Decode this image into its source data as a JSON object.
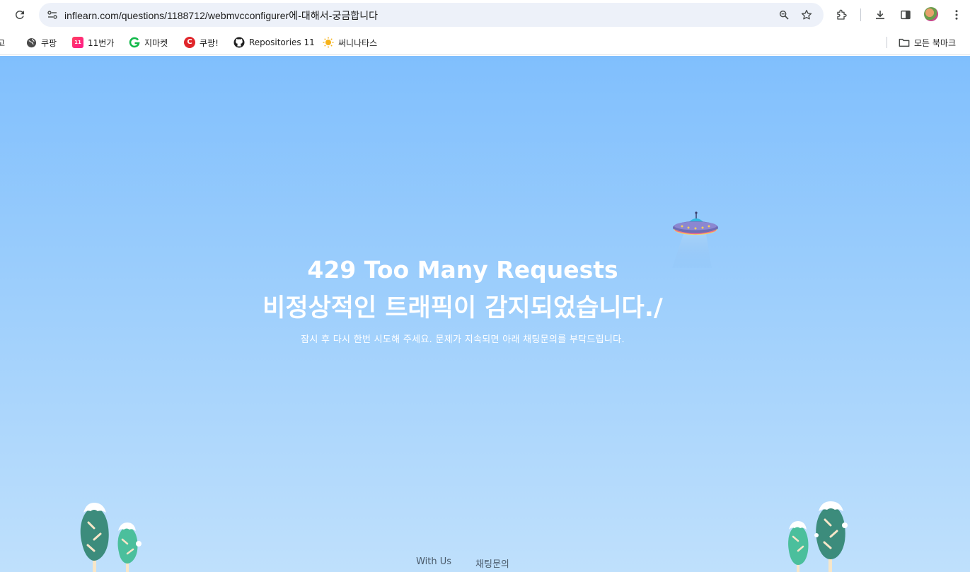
{
  "browser": {
    "url": "inflearn.com/questions/1188712/webmvcconfigurer에-대해서-궁금합니다",
    "bookmarks": [
      {
        "label": "고"
      },
      {
        "label": "쿠팡"
      },
      {
        "label": "11번가"
      },
      {
        "label": "지마켓"
      },
      {
        "label": "쿠팡!"
      },
      {
        "label": "Repositories 11"
      },
      {
        "label": "써니나타스"
      }
    ],
    "all_bookmarks_label": "모든 북마크"
  },
  "page": {
    "title_line1": "429 Too Many Requests",
    "title_line2": "비정상적인 트래픽이 감지되었습니다./",
    "subtitle": "잠시 후 다시 한번 시도해 주세요. 문제가 지속되면 아래 채팅문의를 부탁드립니다.",
    "footer": {
      "with_us": "With Us",
      "chat": "채팅문의"
    }
  }
}
